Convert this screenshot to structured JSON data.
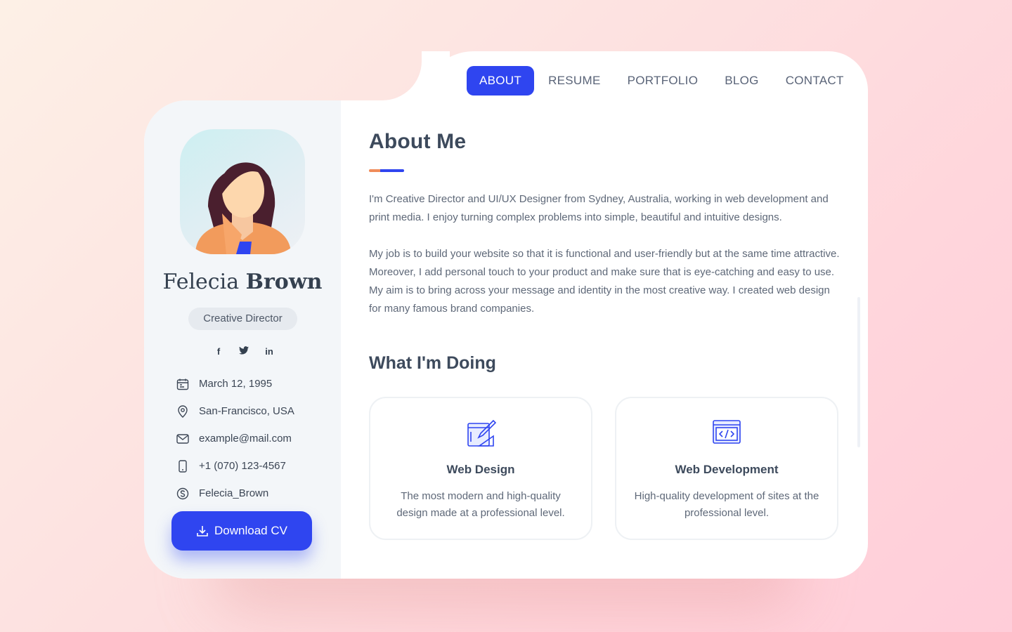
{
  "nav": {
    "items": [
      {
        "label": "ABOUT",
        "active": true
      },
      {
        "label": "RESUME",
        "active": false
      },
      {
        "label": "PORTFOLIO",
        "active": false
      },
      {
        "label": "BLOG",
        "active": false
      },
      {
        "label": "CONTACT",
        "active": false
      }
    ]
  },
  "profile": {
    "first_name": "Felecia",
    "last_name": "Brown",
    "role": "Creative Director",
    "socials": [
      {
        "icon": "facebook-icon",
        "glyph": "f"
      },
      {
        "icon": "twitter-icon",
        "glyph": "🐦"
      },
      {
        "icon": "linkedin-icon",
        "glyph": "in"
      }
    ],
    "info": [
      {
        "icon": "calendar-icon",
        "text": "March 12, 1995"
      },
      {
        "icon": "location-icon",
        "text": "San-Francisco, USA"
      },
      {
        "icon": "mail-icon",
        "text": "example@mail.com"
      },
      {
        "icon": "phone-icon",
        "text": "+1 (070) 123-4567"
      },
      {
        "icon": "skype-icon",
        "text": "Felecia_Brown"
      }
    ],
    "download_label": "Download CV"
  },
  "about": {
    "title": "About Me",
    "paragraph_1": "I'm Creative Director and UI/UX Designer from Sydney, Australia, working in web development and print media. I enjoy turning complex problems into simple, beautiful and intuitive designs.",
    "paragraph_2": "My job is to build your website so that it is functional and user-friendly but at the same time attractive. Moreover, I add personal touch to your product and make sure that is eye-catching and easy to use. My aim is to bring across your message and identity in the most creative way. I created web design for many famous brand companies."
  },
  "services": {
    "title": "What I'm Doing",
    "items": [
      {
        "icon": "design-tools-icon",
        "title": "Web Design",
        "desc": "The most modern and high-quality design made at a professional level."
      },
      {
        "icon": "code-window-icon",
        "title": "Web Development",
        "desc": "High-quality development of sites at the professional level."
      }
    ]
  },
  "colors": {
    "accent": "#2f45f0",
    "accent_secondary": "#f08c5a",
    "text_dark": "#3d4a5c",
    "text_muted": "#5e6878",
    "sidebar_bg": "#f3f6f9"
  }
}
